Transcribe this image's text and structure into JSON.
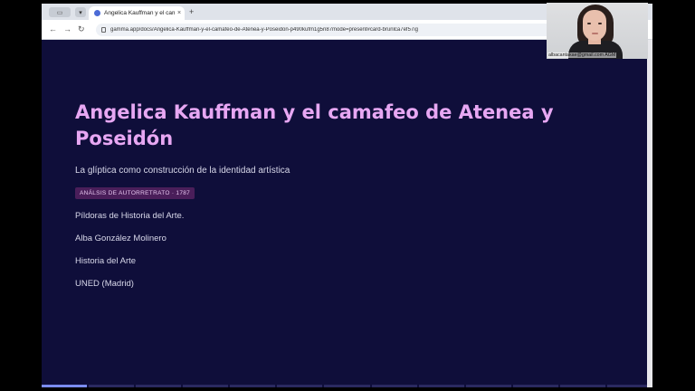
{
  "browser": {
    "tab": {
      "title": "Angelica Kauffman y el cama",
      "close": "×"
    },
    "new_tab": "+",
    "url": "gamma.app/docs/Angelica-Kauffman-y-el-camafeo-de-Atenea-y-Poseidon-p490kufm1g5n87mode=present#card-brunlca7ef57ig",
    "nav": {
      "back": "←",
      "forward": "→",
      "reload": "↻"
    }
  },
  "slide": {
    "title": "Angelica Kauffman y el camafeo de Atenea y Poseidón",
    "subtitle": "La glíptica como construcción de la identidad artística",
    "badge": "ANÁLSIS DE AUTORRETRATO · 1787",
    "lines": [
      "Píldoras de Historia del Arte.",
      "Alba González Molinero",
      "Historia del Arte",
      "UNED (Madrid)"
    ]
  },
  "webcam": {
    "caption": "albacantakae@gmail.com AGM"
  },
  "colors": {
    "slide_bg": "#0f0e3a",
    "title": "#e7a7f3",
    "badge_bg": "#4a1e5a"
  }
}
